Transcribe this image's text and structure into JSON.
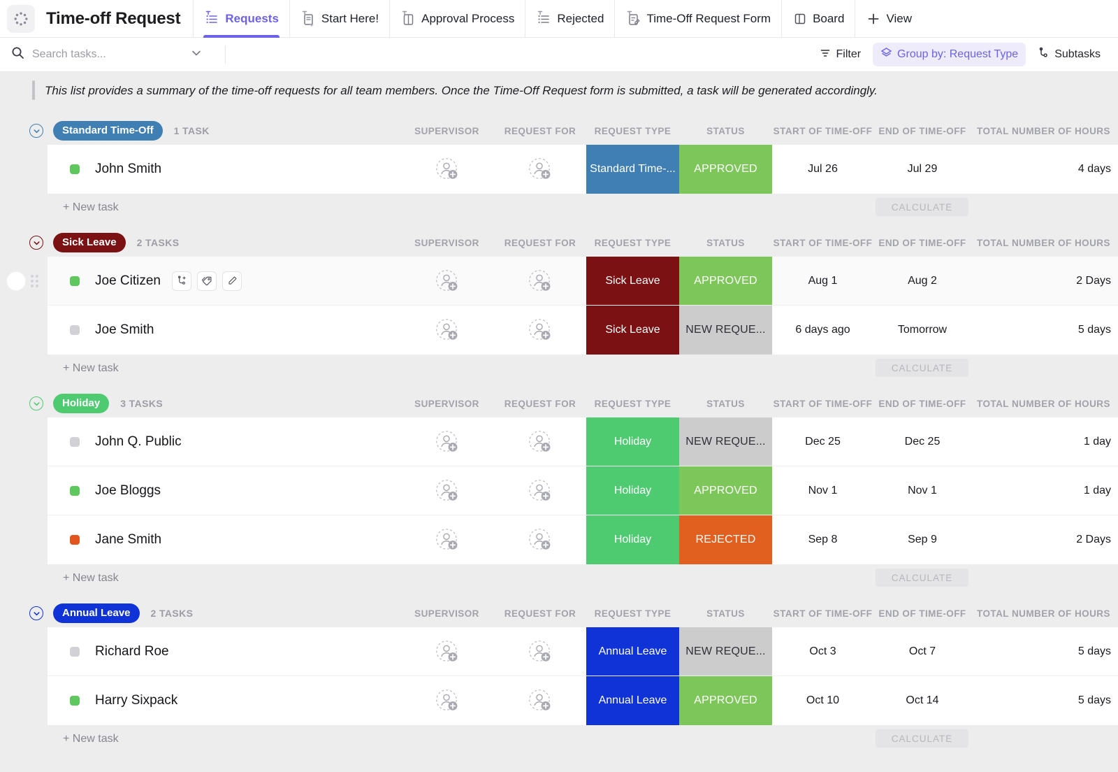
{
  "header": {
    "logo_icon": "clickup-dots-logo",
    "title": "Time-off Request",
    "tabs": [
      {
        "label": "Requests",
        "icon": "pinned-list-icon",
        "active": true
      },
      {
        "label": "Start Here!",
        "icon": "pinned-doc-icon",
        "active": false
      },
      {
        "label": "Approval Process",
        "icon": "pinned-doc-page-icon",
        "active": false
      },
      {
        "label": "Rejected",
        "icon": "pinned-list-icon",
        "active": false
      },
      {
        "label": "Time-Off Request Form",
        "icon": "pinned-form-icon",
        "active": false
      },
      {
        "label": "Board",
        "icon": "board-icon",
        "active": false
      },
      {
        "label": "View",
        "icon": "plus-icon",
        "active": false
      }
    ]
  },
  "toolbar": {
    "search_placeholder": "Search tasks...",
    "search_value": "",
    "search_icon": "search-icon",
    "chevron_icon": "chevron-down-icon",
    "filter_label": "Filter",
    "filter_icon": "filter-icon",
    "groupby_label": "Group by: Request Type",
    "groupby_icon": "layers-icon",
    "subtasks_label": "Subtasks",
    "subtasks_icon": "subtask-icon"
  },
  "banner": {
    "text": "This list provides a summary of the time-off requests for all team members. Once the Time-Off Request form is submitted, a task will be generated accordingly."
  },
  "columns": {
    "supervisor": "SUPERVISOR",
    "request_for": "REQUEST FOR",
    "request_type": "REQUEST TYPE",
    "status": "STATUS",
    "start": "START OF TIME-OFF",
    "end": "END OF TIME-OFF",
    "total": "TOTAL NUMBER OF HOURS"
  },
  "labels": {
    "new_task": "+ New task",
    "calculate": "CALCULATE"
  },
  "colors": {
    "standard_time_off": "#3f7fb3",
    "sick_leave": "#7b1113",
    "holiday": "#4ecb71",
    "annual_leave": "#1033d8",
    "approved": "#7dc75a",
    "new_request": "#cccccc",
    "rejected": "#e2601f",
    "accent": "#6b62e8",
    "dot_green": "#5ec75e",
    "dot_grey": "#d2d2d6",
    "dot_orange": "#e2551f"
  },
  "groups": [
    {
      "name": "Standard Time-Off",
      "badge_color": "#3f7fb3",
      "chev_color": "#3f7fb3",
      "count": "1 TASK",
      "tasks": [
        {
          "name": "John Smith",
          "dot": "#5ec75e",
          "supervisor": "",
          "request_for": "",
          "request_type": "Standard Time-...",
          "type_color": "#3f7fb3",
          "status": "APPROVED",
          "status_color": "#7dc75a",
          "status_text_color": "#ffffff",
          "start": "Jul 26",
          "end": "Jul 29",
          "total": "4 days",
          "hovered": false
        }
      ]
    },
    {
      "name": "Sick Leave",
      "badge_color": "#7b1113",
      "chev_color": "#7b1113",
      "count": "2 TASKS",
      "tasks": [
        {
          "name": "Joe Citizen",
          "dot": "#5ec75e",
          "supervisor": "",
          "request_for": "",
          "request_type": "Sick Leave",
          "type_color": "#7b1113",
          "status": "APPROVED",
          "status_color": "#7dc75a",
          "status_text_color": "#ffffff",
          "start": "Aug 1",
          "end": "Aug 2",
          "total": "2 Days",
          "hovered": true
        },
        {
          "name": "Joe Smith",
          "dot": "#d2d2d6",
          "supervisor": "",
          "request_for": "",
          "request_type": "Sick Leave",
          "type_color": "#7b1113",
          "status": "NEW REQUE...",
          "status_color": "#cccccc",
          "status_text_color": "#303038",
          "start": "6 days ago",
          "end": "Tomorrow",
          "total": "5 days",
          "hovered": false
        }
      ]
    },
    {
      "name": "Holiday",
      "badge_color": "#4ecb71",
      "chev_color": "#4ecb71",
      "count": "3 TASKS",
      "tasks": [
        {
          "name": "John Q. Public",
          "dot": "#d2d2d6",
          "supervisor": "",
          "request_for": "",
          "request_type": "Holiday",
          "type_color": "#4ecb71",
          "status": "NEW REQUE...",
          "status_color": "#cccccc",
          "status_text_color": "#303038",
          "start": "Dec 25",
          "end": "Dec 25",
          "total": "1 day",
          "hovered": false
        },
        {
          "name": "Joe Bloggs",
          "dot": "#5ec75e",
          "supervisor": "",
          "request_for": "",
          "request_type": "Holiday",
          "type_color": "#4ecb71",
          "status": "APPROVED",
          "status_color": "#7dc75a",
          "status_text_color": "#ffffff",
          "start": "Nov 1",
          "end": "Nov 1",
          "total": "1 day",
          "hovered": false
        },
        {
          "name": "Jane Smith",
          "dot": "#e2551f",
          "supervisor": "",
          "request_for": "",
          "request_type": "Holiday",
          "type_color": "#4ecb71",
          "status": "REJECTED",
          "status_color": "#e2601f",
          "status_text_color": "#ffffff",
          "start": "Sep 8",
          "end": "Sep 9",
          "total": "2 Days",
          "hovered": false
        }
      ]
    },
    {
      "name": "Annual Leave",
      "badge_color": "#1033d8",
      "chev_color": "#1033d8",
      "count": "2 TASKS",
      "tasks": [
        {
          "name": "Richard Roe",
          "dot": "#d2d2d6",
          "supervisor": "",
          "request_for": "",
          "request_type": "Annual Leave",
          "type_color": "#1033d8",
          "status": "NEW REQUE...",
          "status_color": "#cccccc",
          "status_text_color": "#303038",
          "start": "Oct 3",
          "end": "Oct 7",
          "total": "5 days",
          "hovered": false
        },
        {
          "name": "Harry Sixpack",
          "dot": "#5ec75e",
          "supervisor": "",
          "request_for": "",
          "request_type": "Annual Leave",
          "type_color": "#1033d8",
          "status": "APPROVED",
          "status_color": "#7dc75a",
          "status_text_color": "#ffffff",
          "start": "Oct 10",
          "end": "Oct 14",
          "total": "5 days",
          "hovered": false
        }
      ]
    }
  ],
  "row_actions": [
    {
      "icon": "subtask-add-icon",
      "name": "add-subtask"
    },
    {
      "icon": "tag-icon",
      "name": "add-tag"
    },
    {
      "icon": "pencil-icon",
      "name": "rename-task"
    }
  ]
}
